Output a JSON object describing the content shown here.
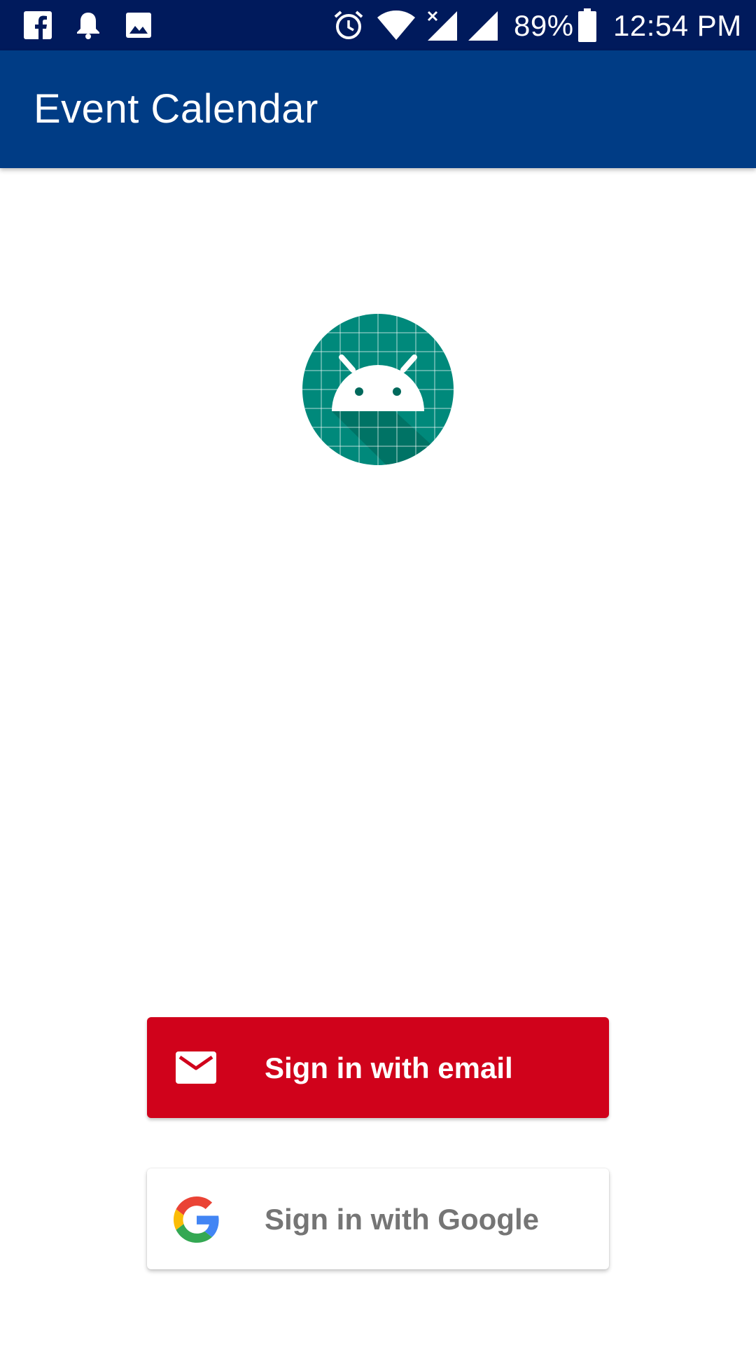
{
  "status_bar": {
    "battery_percent": "89%",
    "time": "12:54 PM",
    "icons": [
      "facebook-icon",
      "notification-bell-icon",
      "image-icon",
      "alarm-icon",
      "wifi-icon",
      "signal-no-data-icon",
      "signal-icon",
      "battery-icon"
    ]
  },
  "app_bar": {
    "title": "Event Calendar",
    "color": "#003c85"
  },
  "logo": {
    "icon": "android-app-icon",
    "color": "#00897b"
  },
  "buttons": {
    "email": {
      "label": "Sign in with email",
      "icon": "mail-icon",
      "color": "#d0021b"
    },
    "google": {
      "label": "Sign in with Google",
      "icon": "google-g-icon",
      "color": "#ffffff"
    }
  }
}
